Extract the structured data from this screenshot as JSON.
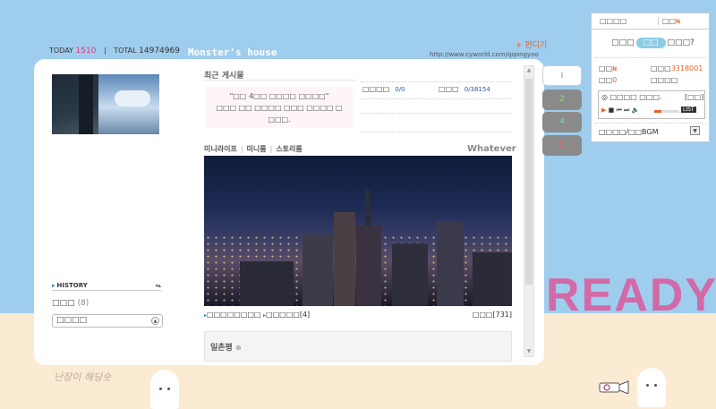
{
  "header": {
    "today_label": "TODAY",
    "today_count": "1510",
    "total_label": "TOTAL",
    "total_count": "14974969",
    "site_title": "Monster's house",
    "edit_link": "+ 편디기",
    "url": "http://www.cyworld.com/qqongyoo"
  },
  "left": {
    "history_label": "HISTORY",
    "history_arrows": "◂▴",
    "folder_label": "□□□",
    "folder_count": "(8)",
    "select_value": "□□□□"
  },
  "recent": {
    "title": "최근 게시물",
    "notice_line1": "\"□□ 4□□ □□□□ □□□□\"",
    "notice_line2": "□□□ □□ □□□□ □□□ □□□□ □",
    "notice_line3": "□□□.",
    "stat1_label": "□□□□",
    "stat1_value": "0/0",
    "stat2_label": "□□□",
    "stat2_value": "0/38154"
  },
  "mini": {
    "tab_minilife": "미니라이프",
    "tab_miniroom": "미니룸",
    "tab_story": "스토리룸",
    "caption": "Whatever",
    "bar_left": "□□□□□□□□",
    "bar_mid": "□□□□□[4]",
    "bar_right": "□□□[731]"
  },
  "guestbook": {
    "title": "일촌평",
    "add_icon": "⊕"
  },
  "tabs": [
    {
      "label": "I",
      "color": "#ffffff",
      "text": "#8a8a8a"
    },
    {
      "label": "2",
      "color": "#8a8a8a",
      "text": "#8fdc7f"
    },
    {
      "label": "4",
      "color": "#8a8a8a",
      "text": "#7fd0c9"
    },
    {
      "label": "5",
      "color": "#8a8a8a",
      "text": "#e86c5f"
    }
  ],
  "right_panel": {
    "tab1": "□□□□",
    "tab2": "□□",
    "new_badge": "N",
    "question_pre": "□□□",
    "question_pill": "□□",
    "question_post": "□□□?",
    "item1_label": "□□",
    "item2_label": "□□□",
    "item2_value": "3318001",
    "item3_label": "□□",
    "item3_value": "0",
    "item4_label": "□□□□",
    "player_now": "□□□□ □□□.",
    "player_box": "[□□]",
    "player_list": "LIST",
    "player_volume": 0.3,
    "bgm_label": "□□□□/□□BGM"
  },
  "decor": {
    "ready": "READY",
    "handwriting": "난장이 해딩숏"
  },
  "colors": {
    "sky": "#9fcdee",
    "sand": "#fbebd3",
    "ready_pink": "#d36aa8",
    "accent_orange": "#e2682b"
  }
}
